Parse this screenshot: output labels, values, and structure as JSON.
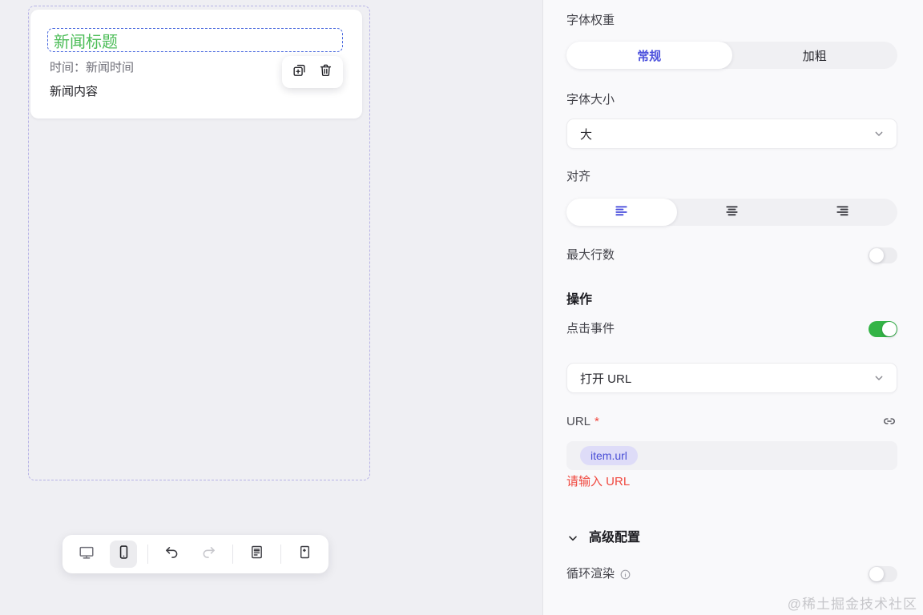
{
  "canvas": {
    "card": {
      "title": "新闻标题",
      "time": "时间：新闻时间",
      "content": "新闻内容"
    }
  },
  "panel": {
    "font_weight": {
      "label": "字体权重",
      "options": [
        "常规",
        "加粗"
      ],
      "selected": "常规"
    },
    "font_size": {
      "label": "字体大小",
      "value": "大"
    },
    "align": {
      "label": "对齐",
      "selected": "left"
    },
    "max_lines": {
      "label": "最大行数",
      "enabled": false
    },
    "actions_section": {
      "title": "操作"
    },
    "click_event": {
      "label": "点击事件",
      "enabled": true
    },
    "event_type": {
      "value": "打开 URL"
    },
    "url_field": {
      "label": "URL",
      "required_mark": "*",
      "value_tag": "item.url",
      "error": "请输入 URL"
    },
    "advanced": {
      "title": "高级配置"
    },
    "loop_render": {
      "label": "循环渲染",
      "enabled": false
    }
  },
  "watermark": "@稀土掘金技术社区",
  "colors": {
    "accent_indigo": "#4d52dd",
    "success_green": "#34b446",
    "error_red": "#f0483f",
    "title_green": "#4dbd58",
    "selection_blue": "#4767de",
    "frame_dash": "#b6b2e6"
  }
}
